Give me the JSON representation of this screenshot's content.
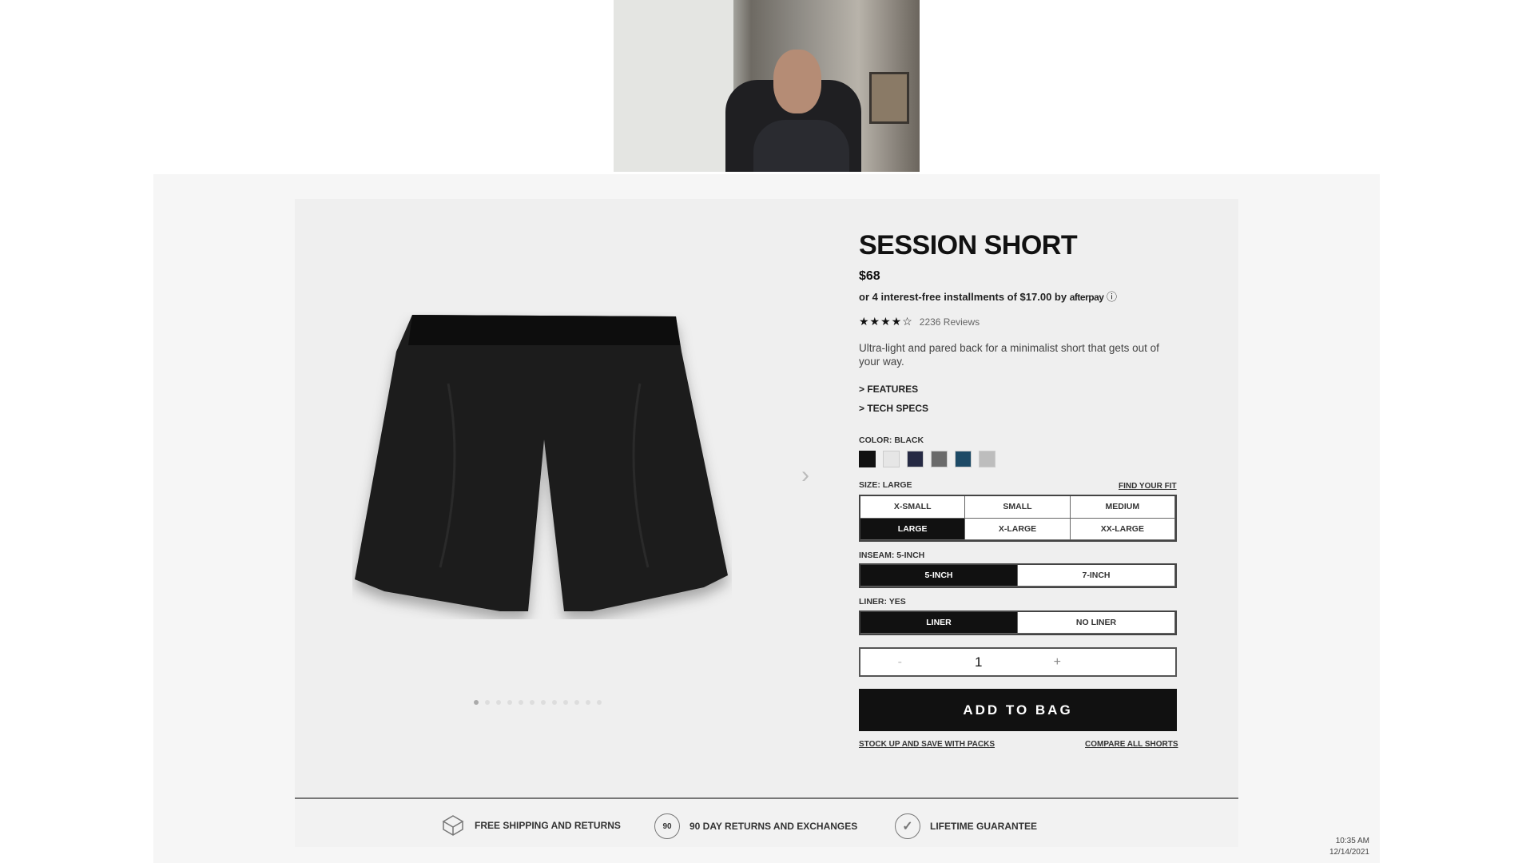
{
  "product": {
    "title": "SESSION SHORT",
    "price": "$68",
    "installments": "or 4 interest-free installments of $17.00 by",
    "afterpay_logo": "afterpay",
    "rating": 4.5,
    "stars": "★★★★☆",
    "reviews": "2236 Reviews",
    "description": "Ultra-light and pared back for a minimalist short that gets out of your way.",
    "features": "> FEATURES",
    "tech_specs": "> TECH SPECS"
  },
  "color": {
    "label": "COLOR: BLACK",
    "swatches": [
      "#111111",
      "#e6e6e6",
      "#262a44",
      "#6a6a6a",
      "#1d4a66",
      "#bdbdbd"
    ]
  },
  "size": {
    "label": "SIZE: LARGE",
    "find_fit": "FIND YOUR FIT",
    "options": [
      "X-SMALL",
      "SMALL",
      "MEDIUM",
      "LARGE",
      "X-LARGE",
      "XX-LARGE"
    ],
    "selected": "LARGE"
  },
  "inseam": {
    "label": "INSEAM: 5-INCH",
    "options": [
      "5-INCH",
      "7-INCH"
    ],
    "selected": "5-INCH"
  },
  "liner": {
    "label": "LINER: YES",
    "options": [
      "LINER",
      "NO LINER"
    ],
    "selected": "LINER"
  },
  "quantity": {
    "minus": "-",
    "value": "1",
    "plus": "+"
  },
  "add_to_bag": "ADD TO BAG",
  "links": {
    "packs": "STOCK UP AND SAVE WITH PACKS",
    "compare": "COMPARE ALL SHORTS"
  },
  "gallery": {
    "image_count": 12,
    "current": 1
  },
  "footer": [
    {
      "icon": "box-icon",
      "label": "FREE SHIPPING AND RETURNS"
    },
    {
      "icon": "90-day-icon",
      "icon_text": "90",
      "label": "90 DAY RETURNS AND EXCHANGES"
    },
    {
      "icon": "check-circle-icon",
      "label": "LIFETIME GUARANTEE"
    }
  ],
  "clock": {
    "time": "10:35 AM",
    "date": "12/14/2021"
  }
}
